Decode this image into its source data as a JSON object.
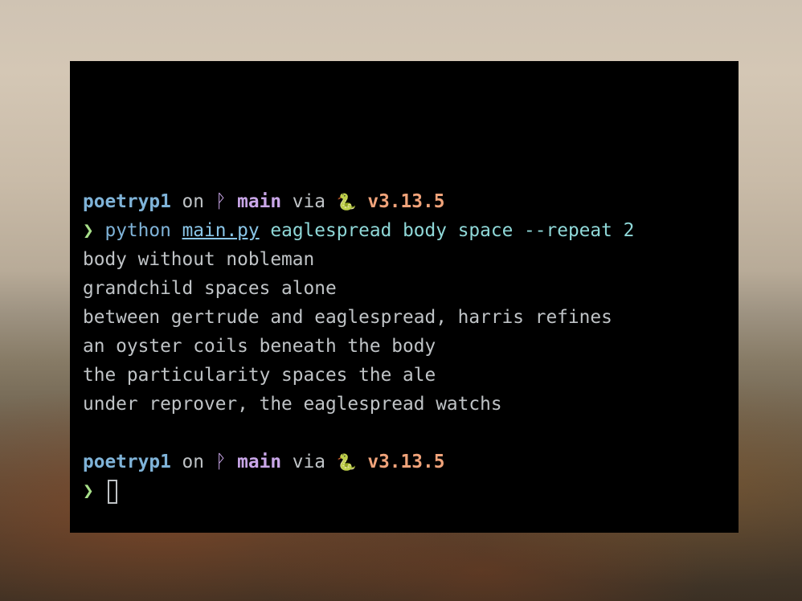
{
  "prompt": {
    "dir": "poetryp1",
    "on": "on",
    "branch_icon": "",
    "branch": "main",
    "via": "via",
    "python_icon": "🐍",
    "python_version": "v3.13.5",
    "chevron": "❯"
  },
  "command": {
    "program": "python",
    "file": "main.py",
    "args": "eaglespread body space --repeat 2"
  },
  "output": [
    "body without nobleman",
    "grandchild spaces alone",
    "between gertrude and eaglespread, harris refines",
    "an oyster coils beneath the body",
    "the particularity spaces the ale",
    "under reprover, the eaglespread watchs"
  ]
}
